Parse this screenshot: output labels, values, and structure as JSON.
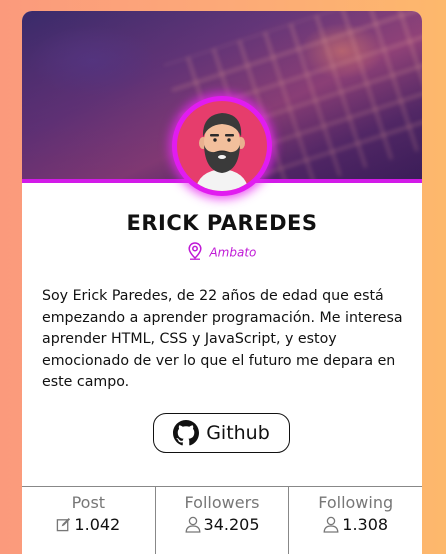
{
  "profile": {
    "name": "ERICK PAREDES",
    "location": "Ambato",
    "bio": "Soy Erick Paredes, de 22 años de edad que está empezando a aprender programación. Me interesa aprender HTML, CSS y JavaScript, y estoy emocionado de ver lo que el futuro me depara en este campo."
  },
  "github_button": {
    "label": "Github",
    "icon": "github-icon"
  },
  "stats": [
    {
      "label": "Post",
      "value": "1.042",
      "icon": "edit-icon"
    },
    {
      "label": "Followers",
      "value": "34.205",
      "icon": "user-icon"
    },
    {
      "label": "Following",
      "value": "1.308",
      "icon": "user-icon"
    }
  ],
  "colors": {
    "accent": "#c01bd6",
    "avatar_border": "#e11cf0",
    "avatar_background": "#e63d6c",
    "page_gradient_start": "#fb9a7c",
    "page_gradient_end": "#fdb86c"
  }
}
